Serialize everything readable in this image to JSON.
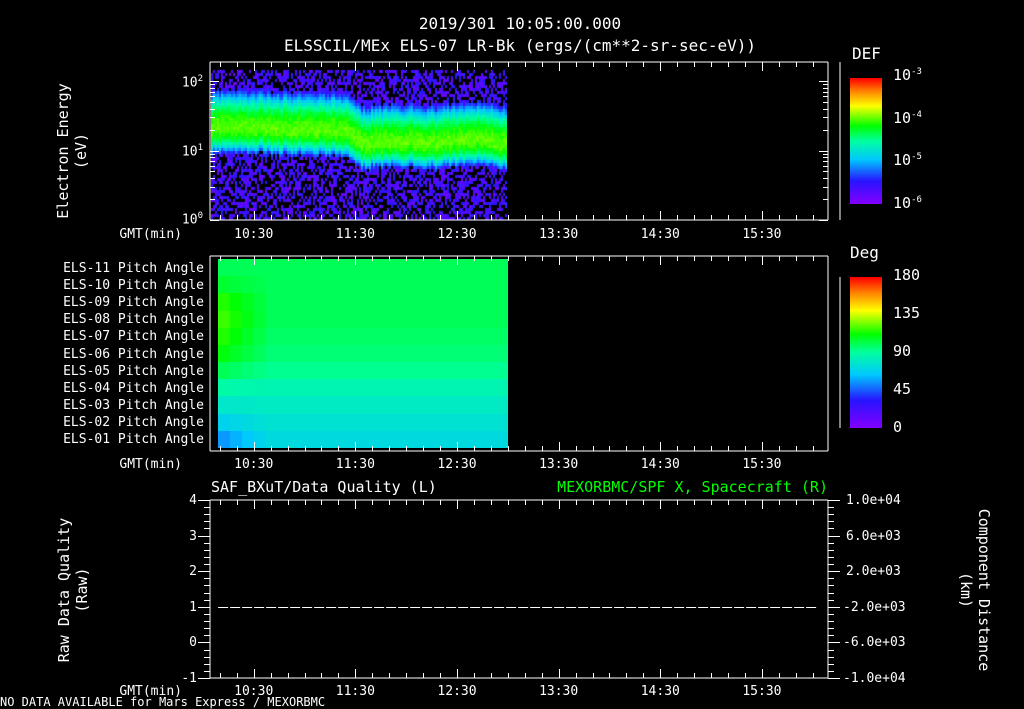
{
  "title": "2019/301 10:05:00.000",
  "chart_data": [
    {
      "type": "heatmap",
      "title": "ELSSCIL/MEx ELS-07 LR-Bk  (ergs/(cm**2-sr-sec-eV))",
      "ylabel_line1": "Electron Energy",
      "ylabel_line2": "(eV)",
      "xlabel": "GMT(min)",
      "x_ticks": [
        "10:30",
        "11:30",
        "12:30",
        "13:30",
        "14:30",
        "15:30"
      ],
      "x_range_hours": [
        10.07,
        16.15
      ],
      "data_end_hours": 13.0,
      "y_scale": "log",
      "y_range_eV": [
        1,
        185
      ],
      "y_ticks": [
        {
          "base": "10",
          "exp": "0"
        },
        {
          "base": "10",
          "exp": "1"
        },
        {
          "base": "10",
          "exp": "2"
        }
      ],
      "band_center_eV": [
        [
          10.07,
          22
        ],
        [
          10.5,
          22
        ],
        [
          11.0,
          20
        ],
        [
          11.4,
          20
        ],
        [
          11.55,
          13
        ],
        [
          12.0,
          14
        ],
        [
          12.3,
          13
        ],
        [
          12.6,
          15
        ],
        [
          13.0,
          13
        ]
      ],
      "peak_log_def": -3.9,
      "colorbar": {
        "label": "DEF",
        "ticks": [
          {
            "base": "10",
            "exp": "-3"
          },
          {
            "base": "10",
            "exp": "-4"
          },
          {
            "base": "10",
            "exp": "-5"
          },
          {
            "base": "10",
            "exp": "-6"
          }
        ],
        "range_log": [
          -6,
          -3
        ]
      }
    },
    {
      "type": "heatmap",
      "xlabel": "GMT(min)",
      "x_ticks": [
        "10:30",
        "11:30",
        "12:30",
        "13:30",
        "14:30",
        "15:30"
      ],
      "columns": 24,
      "rows": [
        {
          "label": "ELS-11 Pitch Angle",
          "left": 100,
          "right": 100
        },
        {
          "label": "ELS-10 Pitch Angle",
          "left": 105,
          "right": 100
        },
        {
          "label": "ELS-09 Pitch Angle",
          "left": 115,
          "right": 100
        },
        {
          "label": "ELS-08 Pitch Angle",
          "left": 118,
          "right": 100
        },
        {
          "label": "ELS-07 Pitch Angle",
          "left": 115,
          "right": 98
        },
        {
          "label": "ELS-06 Pitch Angle",
          "left": 110,
          "right": 96
        },
        {
          "label": "ELS-05 Pitch Angle",
          "left": 100,
          "right": 92
        },
        {
          "label": "ELS-04 Pitch Angle",
          "left": 88,
          "right": 85
        },
        {
          "label": "ELS-03 Pitch Angle",
          "left": 78,
          "right": 80
        },
        {
          "label": "ELS-02 Pitch Angle",
          "left": 68,
          "right": 76
        },
        {
          "label": "ELS-01 Pitch Angle",
          "left": 55,
          "right": 72
        }
      ],
      "colorbar": {
        "label": "Deg",
        "ticks": [
          "180",
          "135",
          "90",
          "45",
          "0"
        ],
        "range": [
          0,
          180
        ]
      }
    },
    {
      "type": "line",
      "title_left": "SAF_BXuT/Data Quality (L)",
      "title_right": "MEXORBMC/SPF X, Spacecraft (R)",
      "ylabel_left_line1": "Raw Data Quality",
      "ylabel_left_line2": "(Raw)",
      "ylabel_right_line1": "Component Distance",
      "ylabel_right_line2": "(km)",
      "xlabel": "GMT(min)",
      "x_ticks": [
        "10:30",
        "11:30",
        "12:30",
        "13:30",
        "14:30",
        "15:30"
      ],
      "y_left_ticks": [
        "4",
        "3",
        "2",
        "1",
        "0",
        "-1"
      ],
      "y_right_ticks": [
        "1.0e+04",
        "6.0e+03",
        "2.0e+03",
        "-2.0e+03",
        "-6.0e+03",
        "-1.0e+04"
      ],
      "y_left_range": [
        -1,
        4
      ],
      "series": [
        {
          "name": "Data Quality",
          "value": 1,
          "x_range_hours": [
            10.15,
            16.05
          ],
          "style": "dashed"
        }
      ],
      "right_color": "#00ff00"
    }
  ],
  "footer": "NO DATA AVAILABLE for Mars Express / MEXORBMC"
}
